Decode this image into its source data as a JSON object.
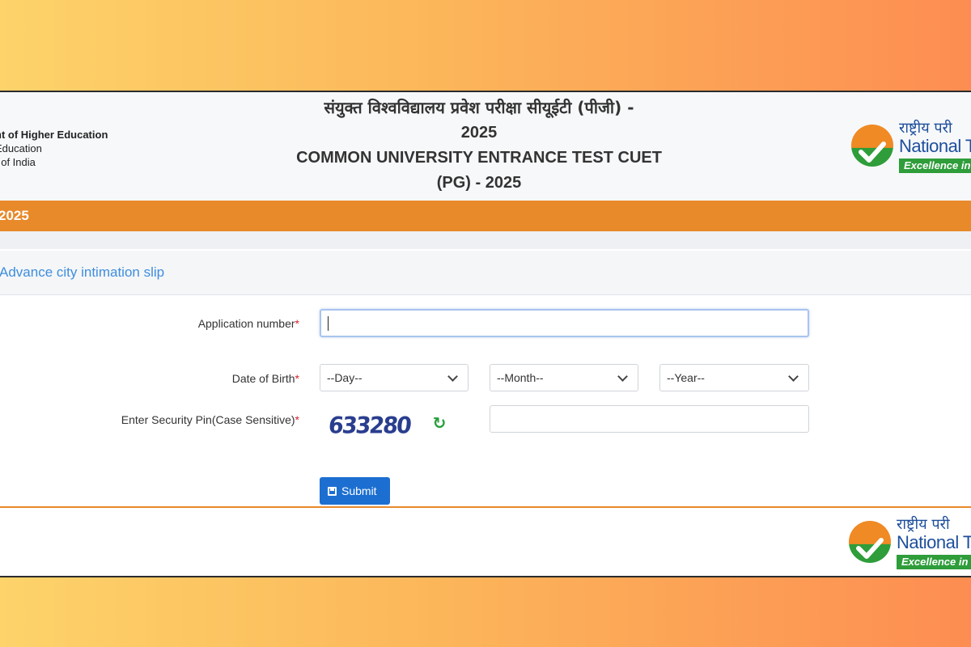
{
  "header": {
    "ministry_line1": "nt of Higher Education",
    "ministry_line2": "Education",
    "ministry_line3": "t of India",
    "title_hi_line1": "संयुक्त विश्वविद्यालय प्रवेश परीक्षा सीयूईटी (पीजी) -",
    "title_hi_line2": "2025",
    "title_en_line1": "COMMON UNIVERSITY ENTRANCE TEST CUET",
    "title_en_line2": "(PG) - 2025",
    "logo_hi": "राष्ट्रीय परी",
    "logo_en": "National Tes",
    "logo_tagline": "Excellence in"
  },
  "orange_bar": {
    "text": "2025"
  },
  "panel": {
    "title": "Advance city intimation slip"
  },
  "form": {
    "application_label": "Application number",
    "required_mark": "*",
    "application_value": "",
    "dob_label": "Date of Birth",
    "day_value": "--Day--",
    "month_value": "--Month--",
    "year_value": "--Year--",
    "pin_label": "Enter Security Pin(Case Sensitive)",
    "captcha_text": "633280",
    "pin_value": "",
    "submit_label": "Submit"
  },
  "footer": {
    "logo_hi": "राष्ट्रीय परी",
    "logo_en": "National Tes",
    "logo_tagline": "Excellence in"
  },
  "colors": {
    "accent_orange": "#e8892a",
    "primary_blue": "#1c6fd1",
    "link_blue": "#3e8ede",
    "required_red": "#d9232e",
    "nta_green": "#2e9d3a"
  }
}
